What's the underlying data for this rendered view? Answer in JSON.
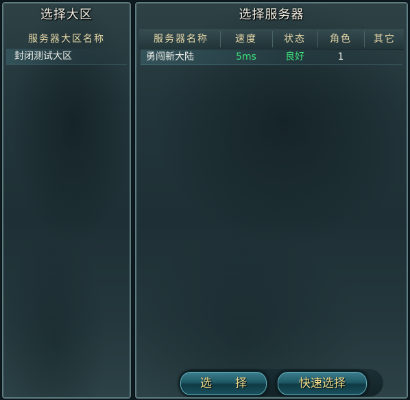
{
  "left_panel": {
    "title": "选择大区",
    "column_header": "服务器大区名称",
    "regions": [
      {
        "name": "封闭测试大区"
      }
    ]
  },
  "right_panel": {
    "title": "选择服务器",
    "columns": {
      "name": "服务器名称",
      "speed": "速度",
      "status": "状态",
      "role": "角色",
      "other": "其它"
    },
    "servers": [
      {
        "name": "勇闯新大陆",
        "speed": "5ms",
        "status": "良好",
        "role": "1",
        "other": ""
      }
    ]
  },
  "buttons": {
    "select": "选　　择",
    "quick_select": "快速选择"
  },
  "colors": {
    "title_text": "#f4f1e6",
    "header_text": "#e8d9a8",
    "good_status": "#3ee07a",
    "button_text": "#f1dd8c"
  }
}
